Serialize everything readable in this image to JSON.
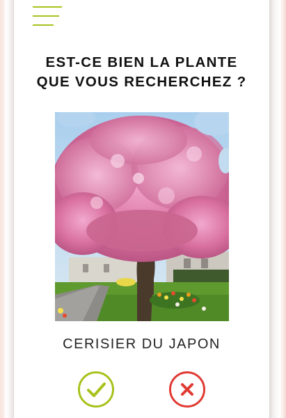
{
  "header": {
    "menu_icon": "hamburger-menu-icon",
    "accent_color": "#a9c11b"
  },
  "question": {
    "line1": "EST-CE BIEN LA PLANTE",
    "line2": "QUE VOUS RECHERCHEZ ?"
  },
  "photo": {
    "subject": "flowering pink cherry tree"
  },
  "result": {
    "plant_name": "CERISIER DU JAPON"
  },
  "actions": {
    "confirm_icon": "checkmark-icon",
    "confirm_color": "#a9c11b",
    "reject_icon": "x-mark-icon",
    "reject_color": "#e03a32"
  }
}
